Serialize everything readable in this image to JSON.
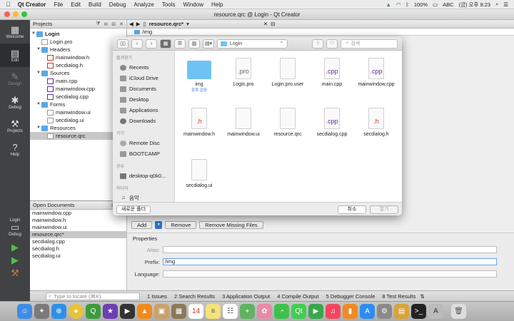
{
  "menubar": {
    "items": [
      "Qt Creator",
      "File",
      "Edit",
      "Build",
      "Debug",
      "Analyze",
      "Tools",
      "Window",
      "Help"
    ],
    "battery": "100%",
    "input_method": "ABC",
    "clock": "(금) 오후 9:23"
  },
  "window": {
    "title": "resource.qrc @ Login - Qt Creator"
  },
  "modes": [
    "Welcome",
    "Edit",
    "Design",
    "Debug",
    "Projects",
    "Help"
  ],
  "kit": {
    "label": "Login",
    "config": "Debug"
  },
  "projects": {
    "header": "Projects",
    "tree": [
      {
        "label": "Login"
      },
      {
        "label": "Login.pro"
      },
      {
        "label": "Headers"
      },
      {
        "label": "mainwindow.h"
      },
      {
        "label": "secdialog.h"
      },
      {
        "label": "Sources"
      },
      {
        "label": "main.cpp"
      },
      {
        "label": "mainwindow.cpp"
      },
      {
        "label": "secdialog.cpp"
      },
      {
        "label": "Forms"
      },
      {
        "label": "mainwindow.ui"
      },
      {
        "label": "secdialog.ui"
      },
      {
        "label": "Resources"
      },
      {
        "label": "resource.qrc"
      }
    ]
  },
  "open_documents": {
    "header": "Open Documents",
    "items": [
      "mainwindow.cpp",
      "mainwindow.h",
      "mainwindow.ui",
      "resource.qrc*",
      "secdialog.cpp",
      "secdialog.h",
      "secdialog.ui"
    ]
  },
  "editor": {
    "tab": "resource.qrc*",
    "prefix_row": "/img",
    "add_label": "Add",
    "remove_label": "Remove",
    "remove_missing_label": "Remove Missing Files",
    "properties_label": "Properties",
    "alias_label": "Alias:",
    "prefix_label": "Prefix:",
    "prefix_value": "/img",
    "language_label": "Language:"
  },
  "statusbar": {
    "locate_placeholder": "Type to locate (⌘K)",
    "tabs": [
      "1 Issues",
      "2 Search Results",
      "3 Application Output",
      "4 Compile Output",
      "5 Debugger Console",
      "8 Test Results"
    ]
  },
  "dialog": {
    "location": "Login",
    "search_placeholder": "검색",
    "sidebar": {
      "favorites_label": "즐겨찾기",
      "favorites": [
        "Recents",
        "iCloud Drive",
        "Documents",
        "Desktop",
        "Applications",
        "Downloads"
      ],
      "devices_label": "기기",
      "devices": [
        "Remote Disc",
        "BOOTCAMP"
      ],
      "shared_label": "공유",
      "shared": [
        "desktop-q0k0..."
      ],
      "media_label": "미디어",
      "media": [
        "음악"
      ]
    },
    "files": [
      {
        "name": "img",
        "badge": "",
        "sub": "항목 없음"
      },
      {
        "name": "Login.pro",
        "badge": ".pro",
        "sub": ""
      },
      {
        "name": "Login.pro.user",
        "badge": "",
        "sub": ""
      },
      {
        "name": "main.cpp",
        "badge": ".cpp",
        "sub": ""
      },
      {
        "name": "mainwindow.cpp",
        "badge": ".cpp",
        "sub": ""
      },
      {
        "name": "mainwindow.h",
        "badge": ".h",
        "sub": ""
      },
      {
        "name": "mainwindow.ui",
        "badge": "",
        "sub": ""
      },
      {
        "name": "resource.qrc",
        "badge": "",
        "sub": ""
      },
      {
        "name": "secdialog.cpp",
        "badge": ".cpp",
        "sub": ""
      },
      {
        "name": "secdialog.h",
        "badge": ".h",
        "sub": ""
      },
      {
        "name": "secdialog.ui",
        "badge": "",
        "sub": ""
      }
    ],
    "new_folder_label": "새로운 폴더",
    "cancel_label": "취소",
    "open_label": "열기"
  },
  "colors": {
    "accent": "#2b73d6",
    "folder": "#6ec3f4",
    "cpp": "#5b2fa0",
    "h": "#c0392b",
    "sidebar_dark": "#404244"
  }
}
